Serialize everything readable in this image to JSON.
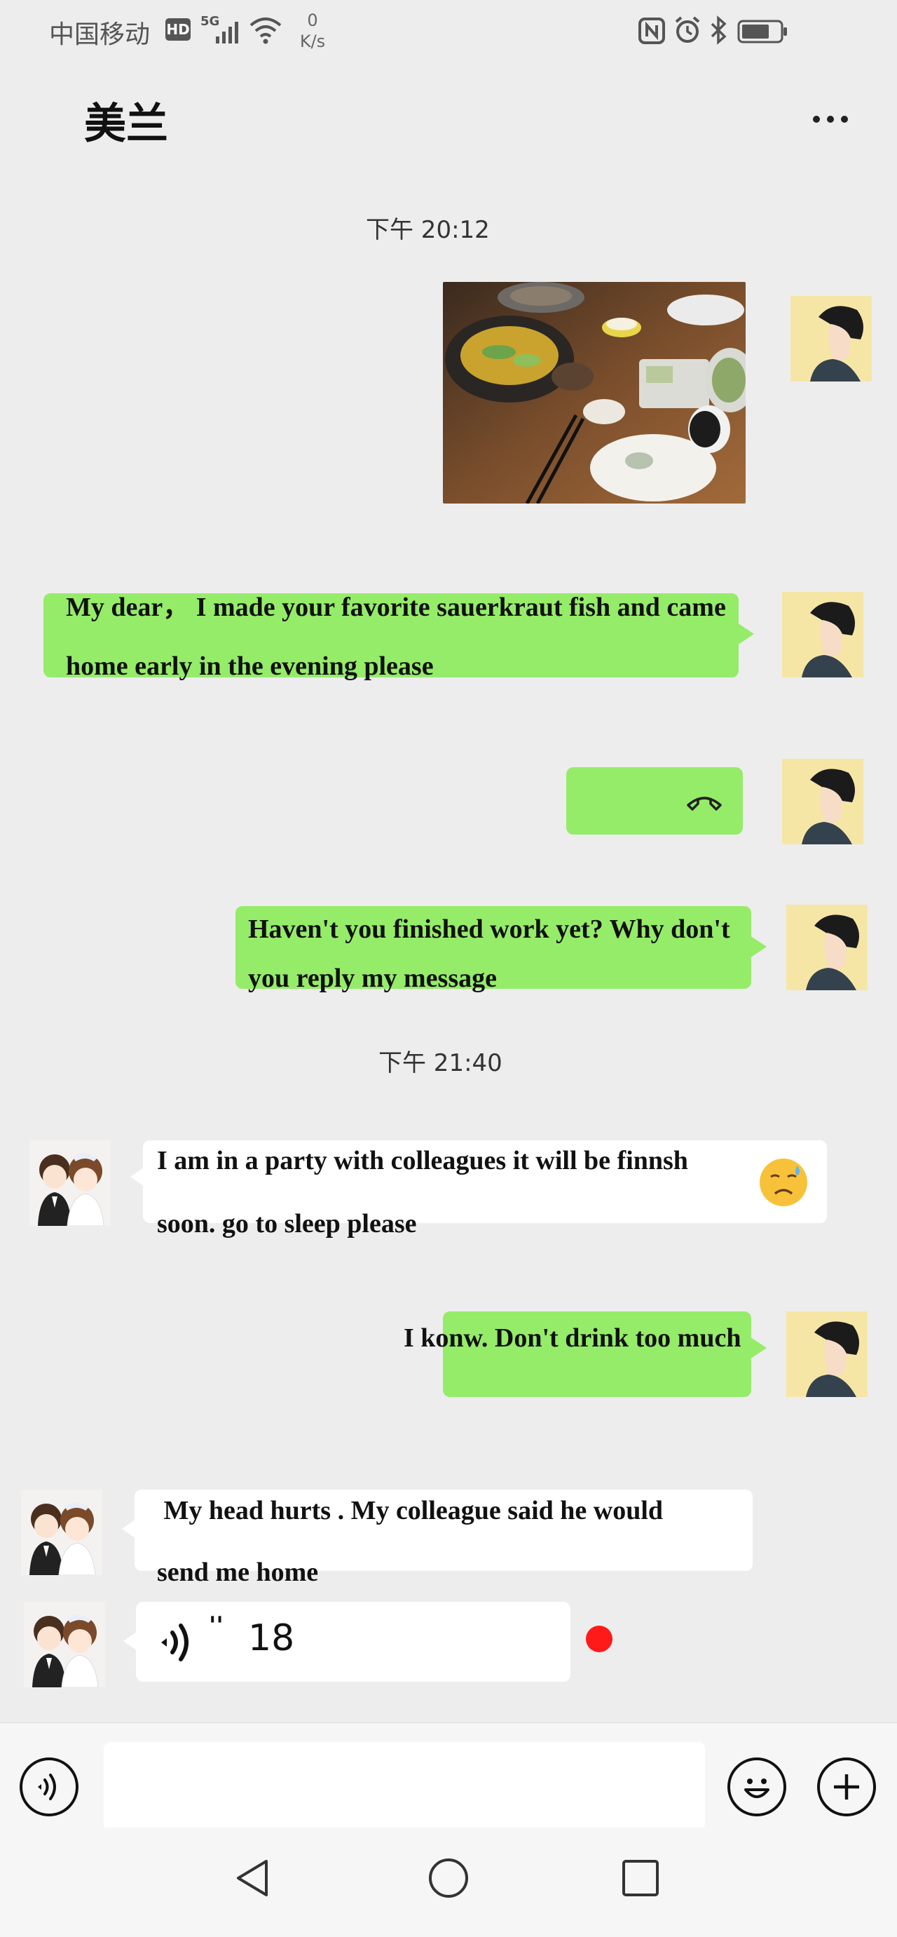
{
  "status_bar": {
    "carrier": "中国移动",
    "hd": "HD",
    "network": "5G",
    "net_speed_value": "0",
    "net_speed_unit": "K/s"
  },
  "header": {
    "title": "美兰"
  },
  "timestamps": [
    "下午 20:12",
    "下午 21:40"
  ],
  "messages": {
    "m2": {
      "text": "My dear， I made your favorite sauerkraut fish and came home early in the evening please"
    },
    "m4": {
      "text": "Haven't you finished work yet? Why don't you reply my message"
    },
    "m5": {
      "text": "I am in a party with colleagues it will be finnsh soon. go to sleep please"
    },
    "m6": {
      "text": "I konw. Don't drink too much"
    },
    "m7": {
      "text": " My head hurts . My colleague said he would send me home"
    },
    "m8": {
      "duration": "18"
    }
  },
  "colors": {
    "background": "#ededed",
    "bubble_green": "#95ec69",
    "bubble_white": "#ffffff",
    "unread_dot": "#ff1a1a"
  },
  "icons": [
    "more-icon",
    "hang-up-icon",
    "crying-emoji-icon",
    "voice-icon",
    "emoji-icon",
    "add-icon",
    "back-nav-icon",
    "home-nav-icon",
    "recents-nav-icon"
  ]
}
